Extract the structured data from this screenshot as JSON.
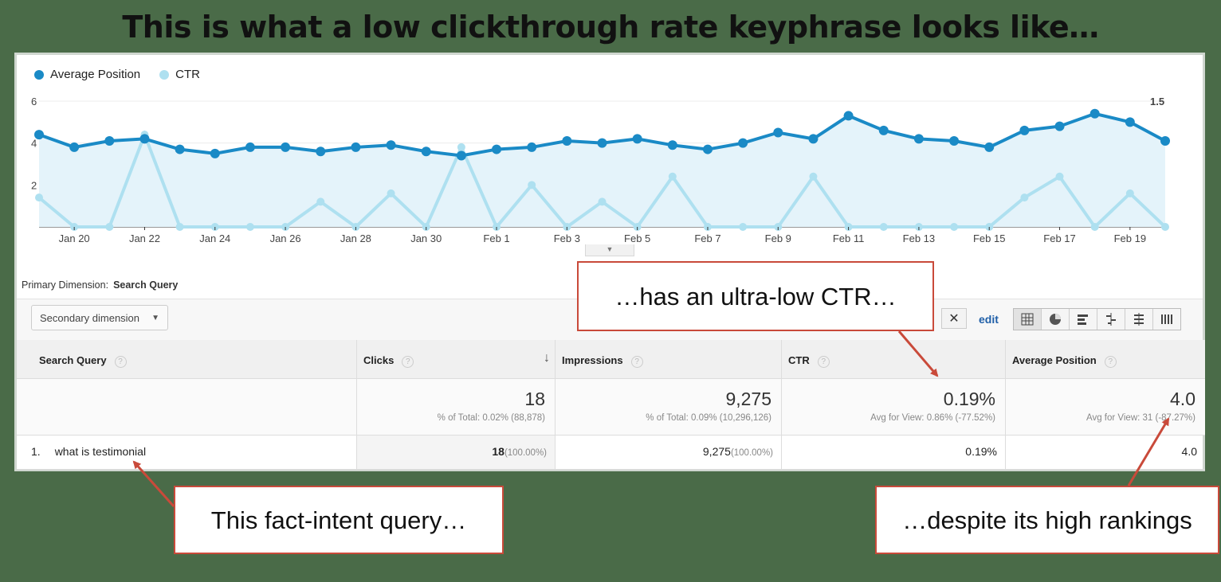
{
  "headline": "This is what a low clickthrough rate keyphrase looks like…",
  "colors": {
    "avg_position": "#1a8ac6",
    "ctr": "#aee0f0",
    "callout_border": "#c94a3a"
  },
  "legend": {
    "avg_position": "Average Position",
    "ctr": "CTR"
  },
  "chart_data": {
    "type": "line",
    "x": [
      "Jan 19",
      "Jan 20",
      "Jan 21",
      "Jan 22",
      "Jan 23",
      "Jan 24",
      "Jan 25",
      "Jan 26",
      "Jan 27",
      "Jan 28",
      "Jan 29",
      "Jan 30",
      "Jan 31",
      "Feb 1",
      "Feb 2",
      "Feb 3",
      "Feb 4",
      "Feb 5",
      "Feb 6",
      "Feb 7",
      "Feb 8",
      "Feb 9",
      "Feb 10",
      "Feb 11",
      "Feb 12",
      "Feb 13",
      "Feb 14",
      "Feb 15",
      "Feb 16",
      "Feb 17",
      "Feb 18",
      "Feb 19",
      "Feb 20"
    ],
    "x_tick_labels": [
      "Jan 20",
      "Jan 22",
      "Jan 24",
      "Jan 26",
      "Jan 28",
      "Jan 30",
      "Feb 1",
      "Feb 3",
      "Feb 5",
      "Feb 7",
      "Feb 9",
      "Feb 11",
      "Feb 13",
      "Feb 15",
      "Feb 17",
      "Feb 19"
    ],
    "series": [
      {
        "name": "Average Position",
        "axis": "left",
        "values": [
          4.4,
          3.8,
          4.1,
          4.2,
          3.7,
          3.5,
          3.8,
          3.8,
          3.6,
          3.8,
          3.9,
          3.6,
          3.4,
          3.7,
          3.8,
          4.1,
          4.0,
          4.2,
          3.9,
          3.7,
          4.0,
          4.5,
          4.2,
          5.3,
          4.6,
          4.2,
          4.1,
          3.8,
          4.6,
          4.8,
          5.4,
          5.0,
          4.1
        ]
      },
      {
        "name": "CTR",
        "axis": "right",
        "values": [
          0.35,
          0,
          0,
          1.1,
          0,
          0,
          0,
          0,
          0.3,
          0,
          0.4,
          0,
          0.95,
          0,
          0.5,
          0,
          0.3,
          0,
          0.6,
          0,
          0,
          0,
          0.6,
          0,
          0,
          0,
          0,
          0,
          0.35,
          0.6,
          0,
          0.4,
          0
        ]
      }
    ],
    "y_left": {
      "ticks": [
        "6",
        "4",
        "2"
      ],
      "ylim": [
        0,
        6
      ]
    },
    "y_right": {
      "ticks": [
        "1.5",
        "1.0",
        "0.5"
      ],
      "ylim": [
        0,
        1.5
      ]
    },
    "legend_position": "top-left",
    "grid": true
  },
  "primary_dimension": {
    "label": "Primary Dimension:",
    "value": "Search Query"
  },
  "secondary_dimension": {
    "label": "Secondary dimension"
  },
  "toolbar": {
    "clear": "✕",
    "edit": "edit"
  },
  "view_icons": [
    "table-view-icon",
    "pie-view-icon",
    "bar-view-icon",
    "comparison-view-icon",
    "pivot-view-icon",
    "term-cloud-view-icon"
  ],
  "table": {
    "headers": [
      "Search Query",
      "Clicks",
      "Impressions",
      "CTR",
      "Average Position"
    ],
    "totals": [
      {
        "value": "18",
        "sub": "% of Total: 0.02% (88,878)"
      },
      {
        "value": "9,275",
        "sub": "% of Total: 0.09% (10,296,126)"
      },
      {
        "value": "0.19%",
        "sub": "Avg for View: 0.86% (-77.52%)"
      },
      {
        "value": "4.0",
        "sub": "Avg for View: 31 (-87.27%)"
      }
    ],
    "rows": [
      {
        "index": "1.",
        "query": "what is testimonial",
        "clicks": "18",
        "clicks_pct": "(100.00%)",
        "impressions": "9,275",
        "impressions_pct": "(100.00%)",
        "ctr": "0.19%",
        "position": "4.0"
      }
    ]
  },
  "callouts": {
    "ctr": "…has an ultra-low CTR…",
    "query": "This fact-intent query…",
    "rank": "…despite its high rankings"
  }
}
